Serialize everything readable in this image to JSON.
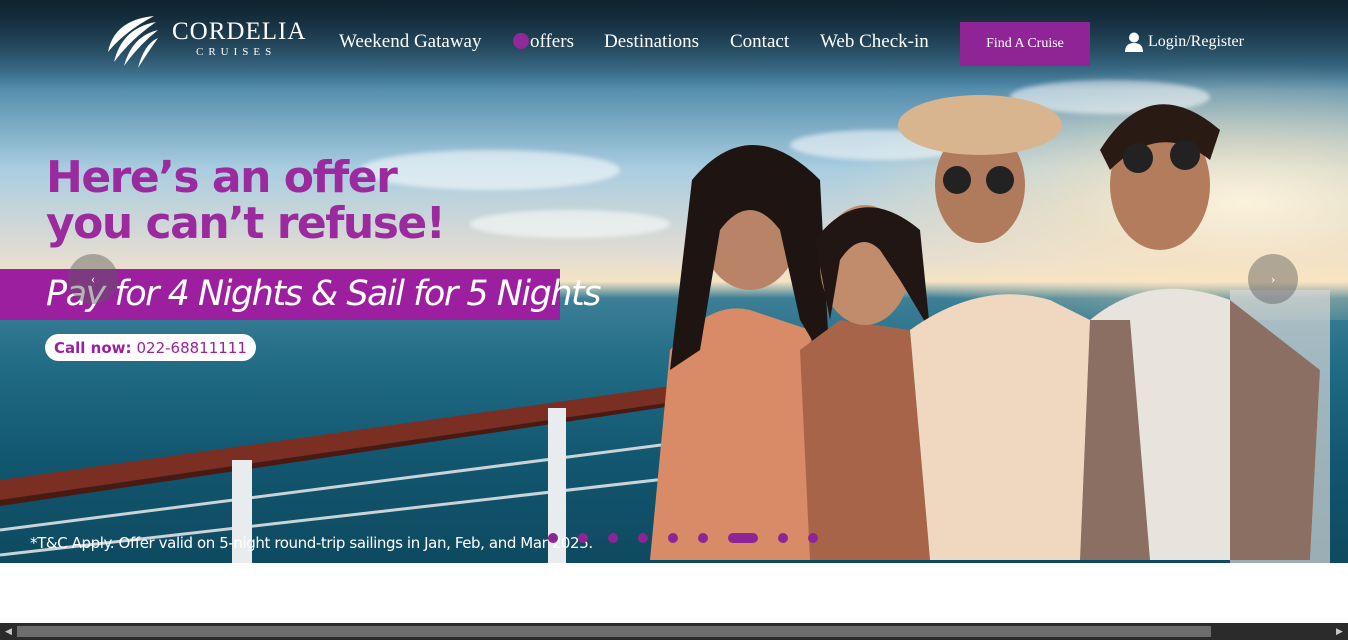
{
  "brand": {
    "name": "CORDELIA",
    "sub": "CRUISES"
  },
  "nav": {
    "links": [
      "Weekend Gataway",
      "offers",
      "Destinations",
      "Contact",
      "Web Check-in"
    ],
    "find_cruise": "Find A Cruise",
    "login": "Login/Register"
  },
  "hero": {
    "headline_1": "Here’s an offer",
    "headline_2": "you can’t refuse!",
    "banner": "Pay for 4 Nights & Sail for 5 Nights",
    "call_label": "Call now:",
    "call_number": "022-68811111",
    "terms": "*T&C Apply. Offer valid on 5-night round-trip sailings in Jan, Feb, and Mar 2025.",
    "prev_arrow": "‹",
    "next_arrow": "›"
  },
  "carousel": {
    "slides": 9,
    "active_index": 6
  },
  "colors": {
    "accent": "#8e2496",
    "banner": "#9b1f9e",
    "headline": "#9b2a9f"
  },
  "icons": {
    "user": "user-icon",
    "logo": "cordelia-logo-icon"
  }
}
